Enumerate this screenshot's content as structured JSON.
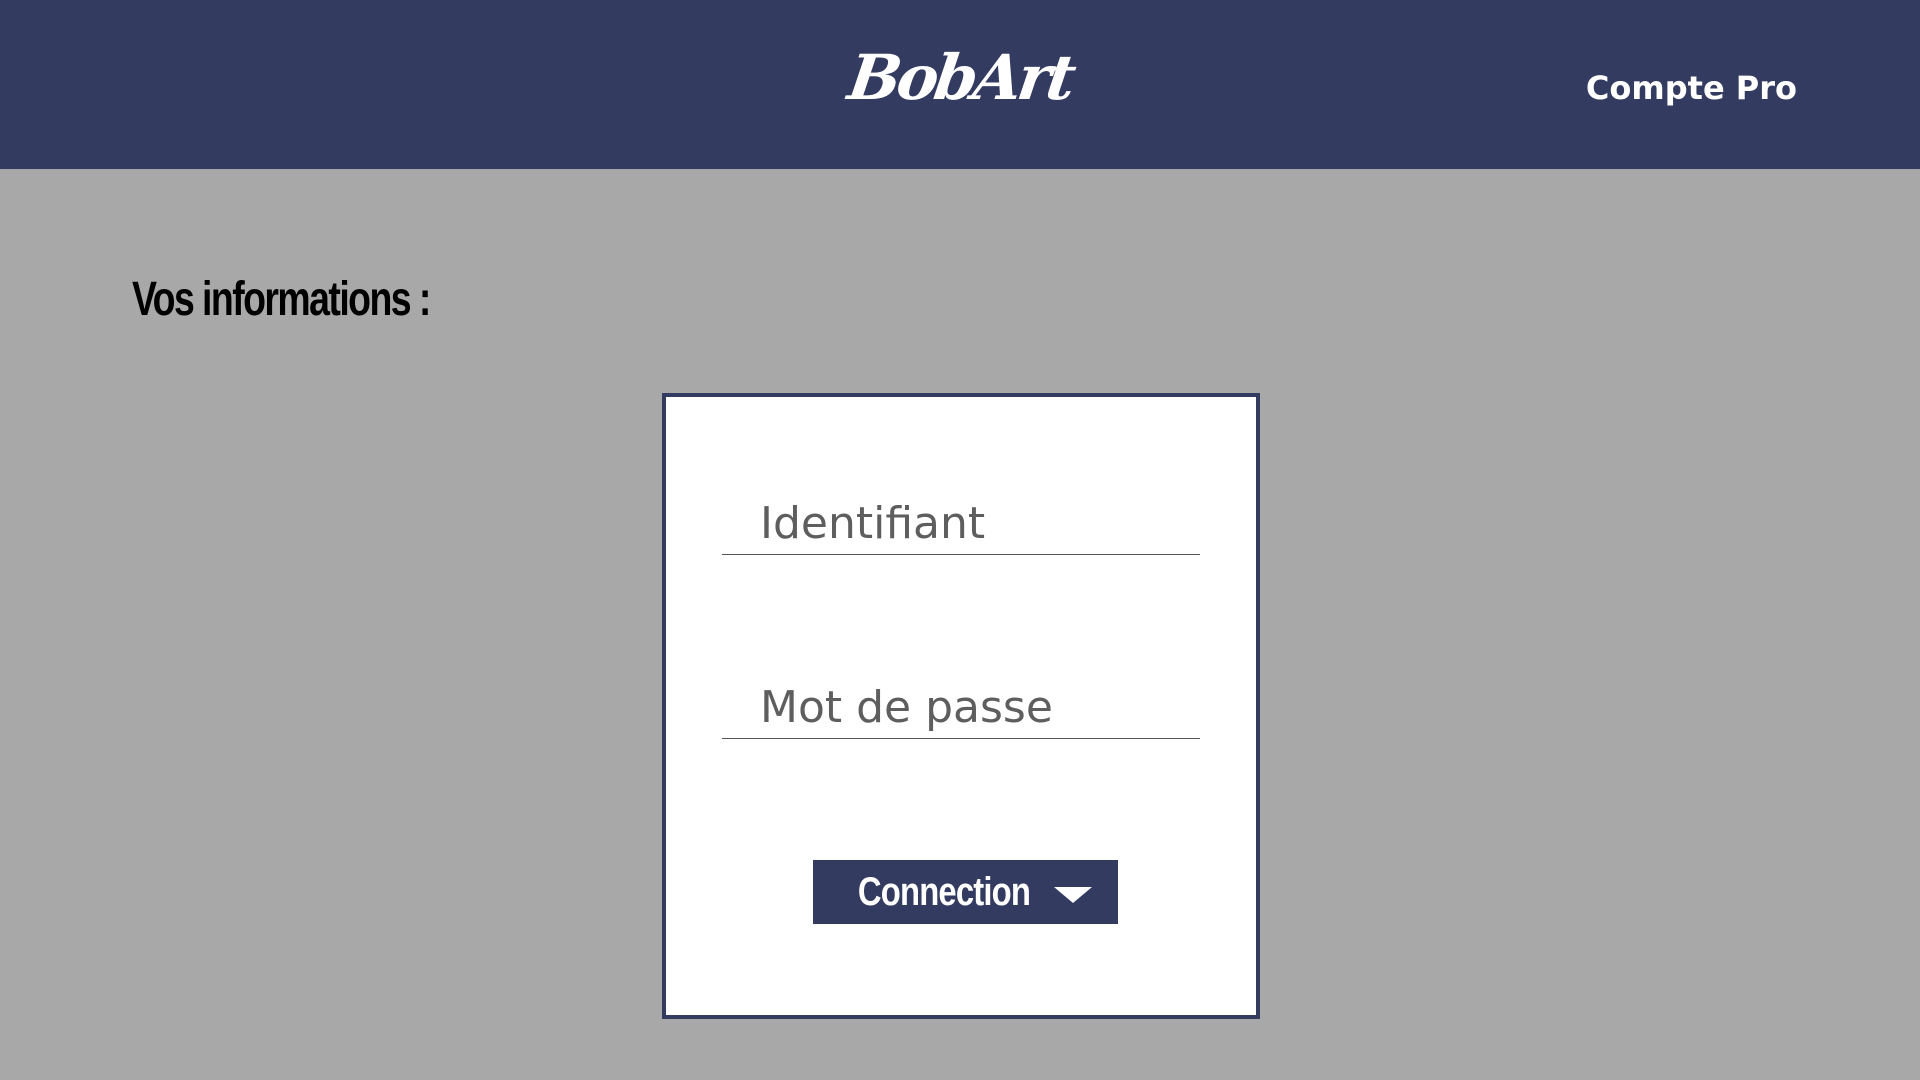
{
  "header": {
    "logo_text": "BobArt",
    "account_link": "Compte Pro"
  },
  "main": {
    "section_title": "Vos informations :"
  },
  "login_form": {
    "identifier_placeholder": "Identifiant",
    "identifier_value": "",
    "password_placeholder": "Mot de passe",
    "password_value": "",
    "submit_label": "Connection",
    "submit_icon": "caret-down-icon"
  },
  "colors": {
    "header_bg": "#343b60",
    "page_bg": "#a8a8a8",
    "card_bg": "#ffffff",
    "button_bg": "#343b60"
  }
}
